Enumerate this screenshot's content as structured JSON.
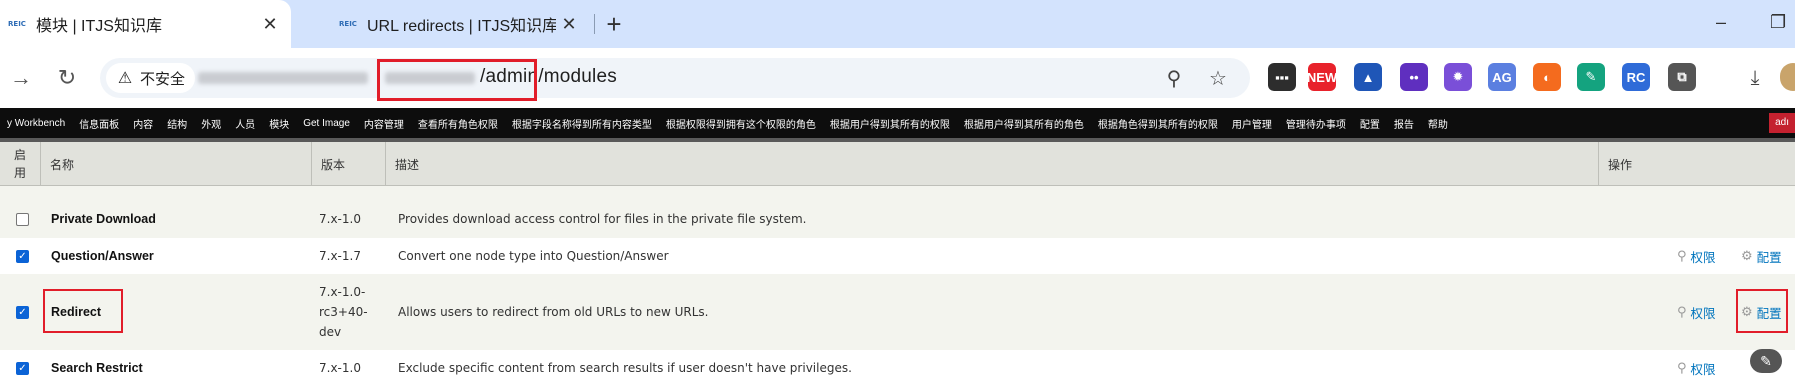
{
  "browser": {
    "tabs": [
      {
        "title": "模块 | ITJS知识库",
        "favicon": "REIC",
        "close": "✕",
        "active": true
      },
      {
        "title": "URL redirects | ITJS知识库",
        "favicon": "REIC",
        "close": "✕",
        "active": false
      }
    ],
    "new_tab": "+",
    "security_label": "不安全",
    "url_path": "/admin/modules",
    "accent": "#e11d2a"
  },
  "extensions": [
    {
      "name": "terminal-ext-icon",
      "label": "▪▪▪",
      "color": "#2d2d2d"
    },
    {
      "name": "new-badge-ext-icon",
      "label": "NEW",
      "color": "#e8222b"
    },
    {
      "name": "triangle-ext-icon",
      "label": "▲",
      "color": "#1f56b7"
    },
    {
      "name": "face-ext-icon",
      "label": "••",
      "color": "#5f2fbf"
    },
    {
      "name": "gear-ext-icon",
      "label": "✹",
      "color": "#7a4fd8"
    },
    {
      "name": "ag-ext-icon",
      "label": "AG",
      "color": "#5b7fe0"
    },
    {
      "name": "orange-ext-icon",
      "label": "◐",
      "color": "#f46b1e"
    },
    {
      "name": "leaf-ext-icon",
      "label": "✎",
      "color": "#14a37f"
    },
    {
      "name": "rc-ext-icon",
      "label": "RC",
      "color": "#2f6bd8"
    },
    {
      "name": "puzzle-ext-icon",
      "label": "⧉",
      "color": "#555555"
    }
  ],
  "adminbar": {
    "items": [
      "y Workbench",
      "信息面板",
      "内容",
      "结构",
      "外观",
      "人员",
      "模块",
      "Get Image",
      "内容管理",
      "查看所有角色权限",
      "根据字段名称得到所有内容类型",
      "根据权限得到拥有这个权限的角色",
      "根据用户得到其所有的权限",
      "根据用户得到其所有的角色",
      "根据角色得到其所有的权限",
      "用户管理",
      "管理待办事项",
      "配置",
      "报告",
      "帮助"
    ],
    "user": "adı"
  },
  "table": {
    "headers": {
      "enable": "启用",
      "name": "名称",
      "version": "版本",
      "description": "描述",
      "operations": "操作"
    },
    "rows": [
      {
        "name": "Private Download",
        "version": "7.x-1.0",
        "description": "Provides download access control for files in the private file system.",
        "checked": false,
        "perm": "",
        "config": ""
      },
      {
        "name": "Question/Answer",
        "version": "7.x-1.7",
        "description": "Convert one node type into Question/Answer",
        "checked": true,
        "perm": "权限",
        "config": "配置"
      },
      {
        "name": "Redirect",
        "version": "7.x-1.0-rc3+40-dev",
        "version_lines": [
          "7.x-1.0-",
          "rc3+40-",
          "dev"
        ],
        "description": "Allows users to redirect from old URLs to new URLs.",
        "checked": true,
        "perm": "权限",
        "config": "配置"
      },
      {
        "name": "Search Restrict",
        "version": "7.x-1.0",
        "description": "Exclude specific content from search results if user doesn't have privileges.",
        "checked": true,
        "perm": "权限",
        "config": ""
      }
    ]
  }
}
